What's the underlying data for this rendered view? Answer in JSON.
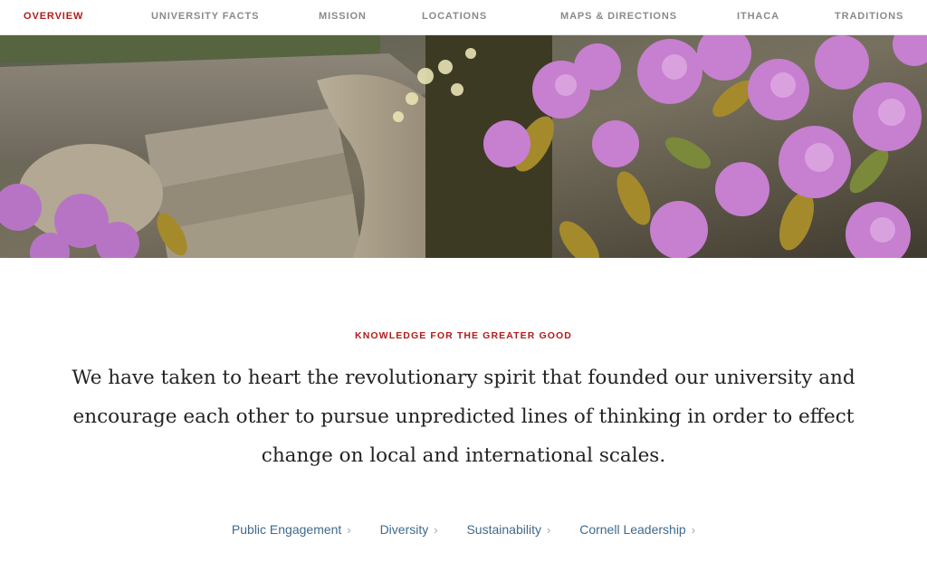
{
  "nav": {
    "items": [
      {
        "label": "OVERVIEW",
        "active": true
      },
      {
        "label": "UNIVERSITY FACTS",
        "active": false
      },
      {
        "label": "MISSION",
        "active": false
      },
      {
        "label": "LOCATIONS",
        "active": false
      },
      {
        "label": "MAPS & DIRECTIONS",
        "active": false
      },
      {
        "label": "ITHACA",
        "active": false
      },
      {
        "label": "TRADITIONS",
        "active": false
      }
    ]
  },
  "hero": {
    "description_icon": "photo-of-flowers-and-stone-steps"
  },
  "content": {
    "eyebrow": "KNOWLEDGE FOR THE GREATER GOOD",
    "lead_lines": [
      "We have taken to heart the revolutionary spirit that founded our university and",
      "encourage each other to pursue unpredicted lines of thinking in order to effect",
      "change on local and international scales."
    ],
    "links": [
      {
        "label": "Public Engagement",
        "icon": "chevron-right-icon"
      },
      {
        "label": "Diversity",
        "icon": "chevron-right-icon"
      },
      {
        "label": "Sustainability",
        "icon": "chevron-right-icon"
      },
      {
        "label": "Cornell Leadership",
        "icon": "chevron-right-icon"
      }
    ]
  },
  "colors": {
    "accent": "#b31b1b",
    "nav_text": "#8a8a8a",
    "link": "#3e6a8e"
  }
}
